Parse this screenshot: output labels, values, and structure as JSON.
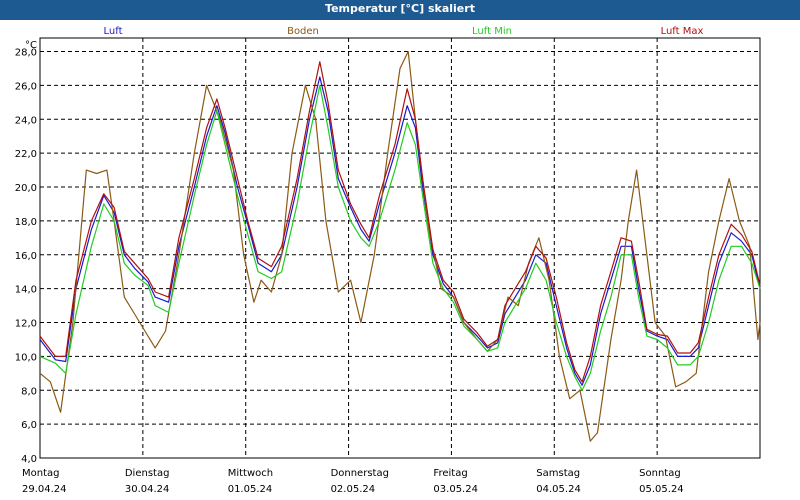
{
  "window": {
    "title": "Temperatur [°C] skaliert"
  },
  "chart_data": {
    "type": "line",
    "title": "Temperatur [°C] skaliert",
    "ylabel": "°C",
    "ylim": [
      4,
      28.8
    ],
    "xlim": [
      0,
      7
    ],
    "grid": true,
    "legend_position": "top",
    "y_ticks": [
      "4,0",
      "6,0",
      "8,0",
      "10,0",
      "12,0",
      "14,0",
      "16,0",
      "18,0",
      "20,0",
      "22,0",
      "24,0",
      "26,0",
      "28,0"
    ],
    "x_ticks": [
      {
        "day": "Montag",
        "date": "29.04.24"
      },
      {
        "day": "Dienstag",
        "date": "30.04.24"
      },
      {
        "day": "Mittwoch",
        "date": "01.05.24"
      },
      {
        "day": "Donnerstag",
        "date": "02.05.24"
      },
      {
        "day": "Freitag",
        "date": "03.05.24"
      },
      {
        "day": "Samstag",
        "date": "04.05.24"
      },
      {
        "day": "Sonntag",
        "date": "05.05.24"
      }
    ],
    "series": [
      {
        "name": "Luft",
        "color": "#1a1acc",
        "points": [
          [
            0,
            11.0
          ],
          [
            0.15,
            9.8
          ],
          [
            0.25,
            9.7
          ],
          [
            0.35,
            14.0
          ],
          [
            0.5,
            17.5
          ],
          [
            0.62,
            19.5
          ],
          [
            0.72,
            18.5
          ],
          [
            0.82,
            16.0
          ],
          [
            0.92,
            15.2
          ],
          [
            1.05,
            14.4
          ],
          [
            1.12,
            13.5
          ],
          [
            1.25,
            13.2
          ],
          [
            1.35,
            16.5
          ],
          [
            1.5,
            20.0
          ],
          [
            1.62,
            23.0
          ],
          [
            1.72,
            24.8
          ],
          [
            1.8,
            23.2
          ],
          [
            1.92,
            20.0
          ],
          [
            2.02,
            17.8
          ],
          [
            2.12,
            15.5
          ],
          [
            2.25,
            15.0
          ],
          [
            2.35,
            16.0
          ],
          [
            2.5,
            20.0
          ],
          [
            2.62,
            24.0
          ],
          [
            2.72,
            26.5
          ],
          [
            2.8,
            24.5
          ],
          [
            2.9,
            20.5
          ],
          [
            3.02,
            18.8
          ],
          [
            3.12,
            17.5
          ],
          [
            3.2,
            16.8
          ],
          [
            3.3,
            19.0
          ],
          [
            3.45,
            22.0
          ],
          [
            3.57,
            24.8
          ],
          [
            3.65,
            23.5
          ],
          [
            3.72,
            20.0
          ],
          [
            3.82,
            16.0
          ],
          [
            3.92,
            14.3
          ],
          [
            4.02,
            13.5
          ],
          [
            4.12,
            12.0
          ],
          [
            4.25,
            11.2
          ],
          [
            4.35,
            10.5
          ],
          [
            4.45,
            10.8
          ],
          [
            4.52,
            12.5
          ],
          [
            4.62,
            13.5
          ],
          [
            4.72,
            14.5
          ],
          [
            4.82,
            16.0
          ],
          [
            4.92,
            15.5
          ],
          [
            5.02,
            13.0
          ],
          [
            5.12,
            10.5
          ],
          [
            5.2,
            9.0
          ],
          [
            5.27,
            8.3
          ],
          [
            5.35,
            9.5
          ],
          [
            5.45,
            12.5
          ],
          [
            5.55,
            14.5
          ],
          [
            5.65,
            16.5
          ],
          [
            5.75,
            16.5
          ],
          [
            5.82,
            14.0
          ],
          [
            5.9,
            11.5
          ],
          [
            6.0,
            11.2
          ],
          [
            6.1,
            11.0
          ],
          [
            6.2,
            10.0
          ],
          [
            6.32,
            10.0
          ],
          [
            6.4,
            10.5
          ],
          [
            6.5,
            13.0
          ],
          [
            6.6,
            15.5
          ],
          [
            6.72,
            17.3
          ],
          [
            6.82,
            16.8
          ],
          [
            6.92,
            16.0
          ],
          [
            7.0,
            14.0
          ]
        ]
      },
      {
        "name": "Boden",
        "color": "#8b5a14",
        "points": [
          [
            0,
            9.0
          ],
          [
            0.1,
            8.5
          ],
          [
            0.2,
            6.7
          ],
          [
            0.32,
            12.0
          ],
          [
            0.45,
            21.0
          ],
          [
            0.55,
            20.8
          ],
          [
            0.65,
            21.0
          ],
          [
            0.72,
            18.0
          ],
          [
            0.82,
            13.5
          ],
          [
            0.92,
            12.5
          ],
          [
            1.02,
            11.5
          ],
          [
            1.12,
            10.5
          ],
          [
            1.22,
            11.5
          ],
          [
            1.35,
            16.0
          ],
          [
            1.5,
            22.0
          ],
          [
            1.62,
            26.0
          ],
          [
            1.75,
            24.0
          ],
          [
            1.88,
            21.0
          ],
          [
            1.98,
            16.0
          ],
          [
            2.08,
            13.2
          ],
          [
            2.15,
            14.5
          ],
          [
            2.25,
            13.8
          ],
          [
            2.35,
            16.0
          ],
          [
            2.45,
            22.0
          ],
          [
            2.58,
            26.0
          ],
          [
            2.68,
            24.0
          ],
          [
            2.78,
            18.0
          ],
          [
            2.9,
            13.8
          ],
          [
            3.02,
            14.5
          ],
          [
            3.12,
            12.0
          ],
          [
            3.25,
            16.0
          ],
          [
            3.38,
            22.0
          ],
          [
            3.5,
            27.0
          ],
          [
            3.58,
            28.0
          ],
          [
            3.65,
            24.0
          ],
          [
            3.78,
            17.5
          ],
          [
            3.9,
            14.0
          ],
          [
            4.02,
            13.5
          ],
          [
            4.12,
            12.0
          ],
          [
            4.25,
            11.0
          ],
          [
            4.35,
            10.3
          ],
          [
            4.45,
            11.0
          ],
          [
            4.55,
            13.5
          ],
          [
            4.65,
            13.0
          ],
          [
            4.75,
            15.5
          ],
          [
            4.85,
            17.0
          ],
          [
            4.95,
            14.5
          ],
          [
            5.05,
            10.0
          ],
          [
            5.15,
            7.5
          ],
          [
            5.25,
            8.0
          ],
          [
            5.35,
            5.0
          ],
          [
            5.42,
            5.5
          ],
          [
            5.55,
            11.0
          ],
          [
            5.65,
            14.5
          ],
          [
            5.72,
            18.0
          ],
          [
            5.8,
            21.0
          ],
          [
            5.88,
            17.0
          ],
          [
            5.98,
            12.0
          ],
          [
            6.08,
            11.2
          ],
          [
            6.18,
            8.2
          ],
          [
            6.28,
            8.5
          ],
          [
            6.38,
            9.0
          ],
          [
            6.5,
            15.0
          ],
          [
            6.6,
            18.0
          ],
          [
            6.7,
            20.5
          ],
          [
            6.8,
            18.0
          ],
          [
            6.9,
            16.5
          ],
          [
            6.98,
            11.0
          ],
          [
            7.0,
            12.0
          ]
        ]
      },
      {
        "name": "Luft Min",
        "color": "#22cc22",
        "points": [
          [
            0,
            10.0
          ],
          [
            0.15,
            9.6
          ],
          [
            0.25,
            9.0
          ],
          [
            0.35,
            12.5
          ],
          [
            0.5,
            16.5
          ],
          [
            0.62,
            19.0
          ],
          [
            0.72,
            18.0
          ],
          [
            0.82,
            15.5
          ],
          [
            0.92,
            14.8
          ],
          [
            1.05,
            14.2
          ],
          [
            1.12,
            13.0
          ],
          [
            1.25,
            12.6
          ],
          [
            1.35,
            15.5
          ],
          [
            1.5,
            19.5
          ],
          [
            1.62,
            22.5
          ],
          [
            1.72,
            24.5
          ],
          [
            1.8,
            22.5
          ],
          [
            1.92,
            19.5
          ],
          [
            2.02,
            17.2
          ],
          [
            2.12,
            15.0
          ],
          [
            2.25,
            14.6
          ],
          [
            2.35,
            15.0
          ],
          [
            2.5,
            19.0
          ],
          [
            2.62,
            23.0
          ],
          [
            2.72,
            26.0
          ],
          [
            2.8,
            23.5
          ],
          [
            2.9,
            20.0
          ],
          [
            3.02,
            18.0
          ],
          [
            3.12,
            17.0
          ],
          [
            3.2,
            16.5
          ],
          [
            3.3,
            18.0
          ],
          [
            3.45,
            21.0
          ],
          [
            3.57,
            23.8
          ],
          [
            3.65,
            22.5
          ],
          [
            3.72,
            19.5
          ],
          [
            3.82,
            15.5
          ],
          [
            3.92,
            14.0
          ],
          [
            4.02,
            13.2
          ],
          [
            4.12,
            11.8
          ],
          [
            4.25,
            11.0
          ],
          [
            4.35,
            10.3
          ],
          [
            4.45,
            10.5
          ],
          [
            4.52,
            12.0
          ],
          [
            4.62,
            13.0
          ],
          [
            4.72,
            14.0
          ],
          [
            4.82,
            15.5
          ],
          [
            4.92,
            14.5
          ],
          [
            5.02,
            12.0
          ],
          [
            5.12,
            10.0
          ],
          [
            5.2,
            8.8
          ],
          [
            5.27,
            8.0
          ],
          [
            5.35,
            9.0
          ],
          [
            5.45,
            11.5
          ],
          [
            5.55,
            13.5
          ],
          [
            5.65,
            16.0
          ],
          [
            5.75,
            16.0
          ],
          [
            5.82,
            13.5
          ],
          [
            5.9,
            11.2
          ],
          [
            6.0,
            11.0
          ],
          [
            6.1,
            10.5
          ],
          [
            6.2,
            9.5
          ],
          [
            6.32,
            9.5
          ],
          [
            6.4,
            10.0
          ],
          [
            6.5,
            12.0
          ],
          [
            6.6,
            14.5
          ],
          [
            6.72,
            16.5
          ],
          [
            6.82,
            16.5
          ],
          [
            6.92,
            15.5
          ],
          [
            7.0,
            14.0
          ]
        ]
      },
      {
        "name": "Luft Max",
        "color": "#b01010",
        "points": [
          [
            0,
            11.2
          ],
          [
            0.15,
            10.0
          ],
          [
            0.25,
            10.0
          ],
          [
            0.35,
            14.5
          ],
          [
            0.5,
            18.0
          ],
          [
            0.62,
            19.6
          ],
          [
            0.72,
            18.8
          ],
          [
            0.82,
            16.2
          ],
          [
            0.92,
            15.5
          ],
          [
            1.05,
            14.6
          ],
          [
            1.12,
            13.8
          ],
          [
            1.25,
            13.5
          ],
          [
            1.35,
            17.0
          ],
          [
            1.5,
            20.5
          ],
          [
            1.62,
            23.5
          ],
          [
            1.72,
            25.2
          ],
          [
            1.8,
            23.5
          ],
          [
            1.92,
            20.5
          ],
          [
            2.02,
            18.0
          ],
          [
            2.12,
            15.8
          ],
          [
            2.25,
            15.3
          ],
          [
            2.35,
            16.5
          ],
          [
            2.5,
            20.5
          ],
          [
            2.62,
            24.5
          ],
          [
            2.72,
            27.4
          ],
          [
            2.8,
            25.0
          ],
          [
            2.9,
            21.0
          ],
          [
            3.02,
            19.0
          ],
          [
            3.12,
            17.8
          ],
          [
            3.2,
            17.0
          ],
          [
            3.3,
            19.5
          ],
          [
            3.45,
            22.5
          ],
          [
            3.57,
            25.8
          ],
          [
            3.65,
            24.0
          ],
          [
            3.72,
            20.5
          ],
          [
            3.82,
            16.3
          ],
          [
            3.92,
            14.5
          ],
          [
            4.02,
            13.8
          ],
          [
            4.12,
            12.2
          ],
          [
            4.25,
            11.4
          ],
          [
            4.35,
            10.6
          ],
          [
            4.45,
            11.0
          ],
          [
            4.52,
            13.0
          ],
          [
            4.62,
            14.0
          ],
          [
            4.72,
            15.0
          ],
          [
            4.82,
            16.5
          ],
          [
            4.92,
            15.8
          ],
          [
            5.02,
            13.5
          ],
          [
            5.12,
            10.8
          ],
          [
            5.2,
            9.2
          ],
          [
            5.27,
            8.5
          ],
          [
            5.35,
            10.0
          ],
          [
            5.45,
            13.0
          ],
          [
            5.55,
            15.0
          ],
          [
            5.65,
            17.0
          ],
          [
            5.75,
            16.8
          ],
          [
            5.82,
            14.5
          ],
          [
            5.9,
            11.6
          ],
          [
            6.0,
            11.3
          ],
          [
            6.1,
            11.2
          ],
          [
            6.2,
            10.2
          ],
          [
            6.32,
            10.2
          ],
          [
            6.4,
            10.8
          ],
          [
            6.5,
            13.5
          ],
          [
            6.6,
            16.0
          ],
          [
            6.72,
            17.8
          ],
          [
            6.82,
            17.2
          ],
          [
            6.92,
            16.2
          ],
          [
            7.0,
            14.2
          ]
        ]
      }
    ]
  }
}
